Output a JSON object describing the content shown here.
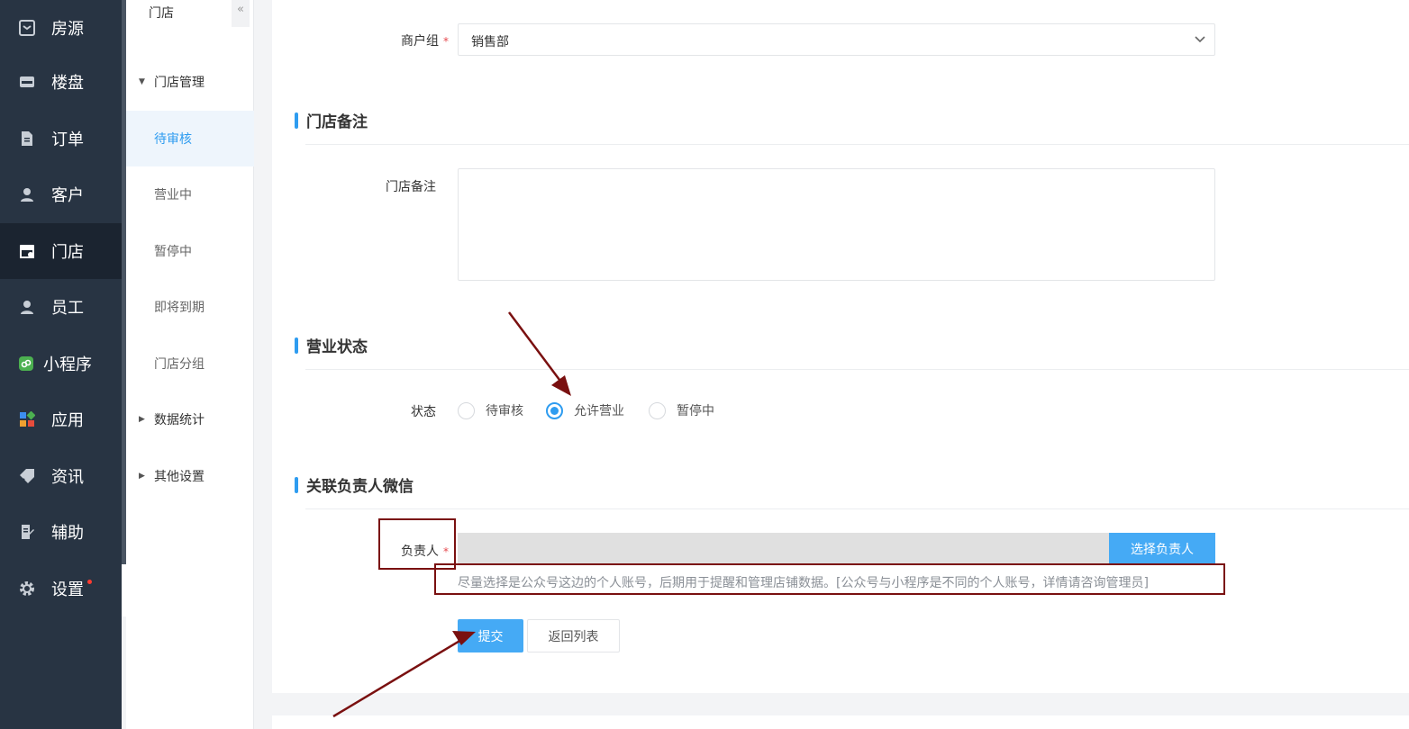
{
  "nav": {
    "items": [
      {
        "label": "房源",
        "icon": "box-icon"
      },
      {
        "label": "楼盘",
        "icon": "building-icon"
      },
      {
        "label": "订单",
        "icon": "document-icon"
      },
      {
        "label": "客户",
        "icon": "user-icon"
      },
      {
        "label": "门店",
        "icon": "store-icon"
      },
      {
        "label": "员工",
        "icon": "user-icon"
      },
      {
        "label": "小程序",
        "icon": "miniprogram-icon"
      },
      {
        "label": "应用",
        "icon": "apps-icon"
      },
      {
        "label": "资讯",
        "icon": "tag-icon"
      },
      {
        "label": "辅助",
        "icon": "edit-doc-icon"
      },
      {
        "label": "设置",
        "icon": "gear-icon"
      }
    ],
    "active_index": 4,
    "colors": {
      "bg": "#283443",
      "active_bg": "#1b2430"
    }
  },
  "submenu": {
    "title": "门店",
    "collapse_symbol": "«",
    "groups": [
      {
        "label": "门店管理",
        "expanded": true
      },
      {
        "label": "数据统计",
        "expanded": false
      },
      {
        "label": "其他设置",
        "expanded": false
      }
    ],
    "items": [
      "待审核",
      "营业中",
      "暂停中",
      "即将到期",
      "门店分组"
    ],
    "active_item": "待审核"
  },
  "form": {
    "merchant_group": {
      "label": "商户组",
      "required_mark": "*",
      "value": "销售部"
    },
    "remark_section": {
      "title": "门店备注",
      "field_label": "门店备注",
      "value": ""
    },
    "status_section": {
      "title": "营业状态",
      "field_label": "状态",
      "options": [
        "待审核",
        "允许营业",
        "暂停中"
      ],
      "selected": "允许营业"
    },
    "wechat_section": {
      "title": "关联负责人微信",
      "field_label": "负责人",
      "required_mark": "*",
      "value": "",
      "choose_button": "选择负责人",
      "hint": "尽量选择是公众号这边的个人账号，后期用于提醒和管理店铺数据。[公众号与小程序是不同的个人账号，详情请咨询管理员]"
    },
    "submit_button": "提交",
    "back_button": "返回列表"
  },
  "colors": {
    "accent": "#2e9cf0",
    "button": "#45aaf5",
    "annotation": "#7a1010",
    "required": "#e5484d"
  }
}
